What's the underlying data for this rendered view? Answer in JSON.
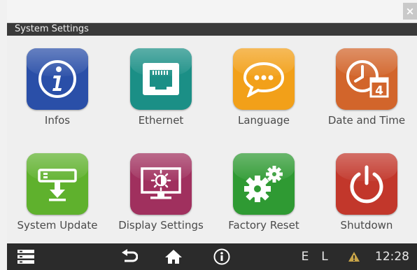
{
  "window": {
    "close_glyph": "×"
  },
  "title": "System Settings",
  "tiles": [
    {
      "label": "Infos",
      "icon": "info-icon",
      "color": "#2a4fa8"
    },
    {
      "label": "Ethernet",
      "icon": "ethernet-icon",
      "color": "#1b8f86"
    },
    {
      "label": "Language",
      "icon": "speech-bubble-icon",
      "color": "#f2a019"
    },
    {
      "label": "Date and Time",
      "icon": "clock-calendar-icon",
      "color": "#d2652b",
      "calendar_day": "4"
    },
    {
      "label": "System Update",
      "icon": "system-update-icon",
      "color": "#5fb12d"
    },
    {
      "label": "Display Settings",
      "icon": "display-brightness-icon",
      "color": "#a0305e"
    },
    {
      "label": "Factory Reset",
      "icon": "gears-icon",
      "color": "#2f9a33"
    },
    {
      "label": "Shutdown",
      "icon": "power-icon",
      "color": "#c2372b"
    }
  ],
  "bottombar": {
    "menu_icon": "menu-list-icon",
    "back_icon": "back-arrow-icon",
    "home_icon": "home-icon",
    "info_icon": "info-circle-icon",
    "status_e": "E",
    "status_l": "L",
    "warning_icon": "warning-icon",
    "time": "12:28"
  }
}
